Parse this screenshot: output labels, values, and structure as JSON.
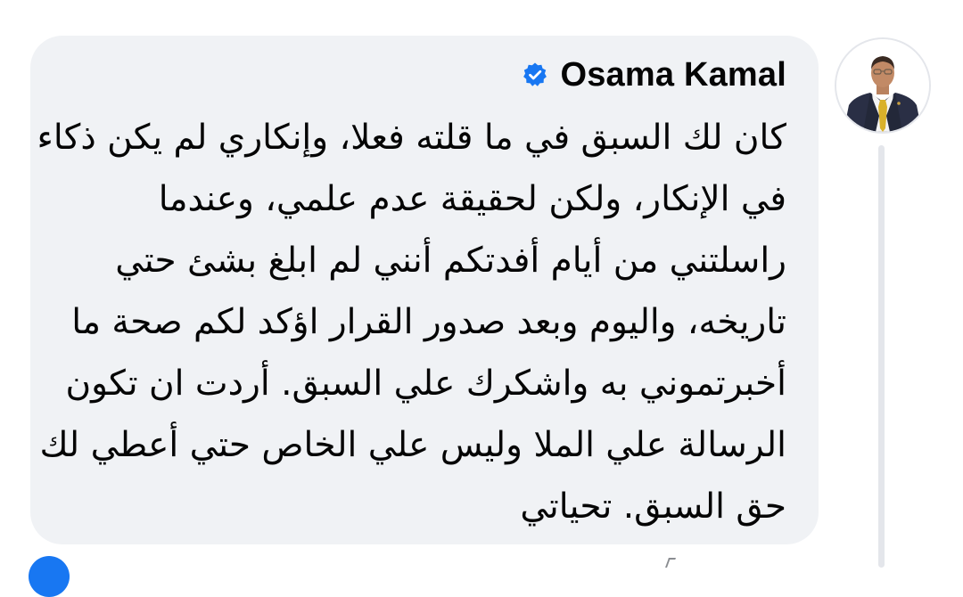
{
  "comment": {
    "author": "Osama Kamal",
    "verified_icon": "verified-badge-icon",
    "accent_color": "#1877f2",
    "bubble_color": "#f0f2f5",
    "lines": [
      "كان لك السبق في ما قلته فعلا، وإنكاري لم يكن ذكاء",
      "في الإنكار، ولكن لحقيقة عدم علمي، وعندما",
      "راسلتني من أيام أفدتكم أنني لم ابلغ بشئ حتي",
      "تاريخه، واليوم وبعد صدور القرار اؤكد لكم صحة ما",
      "أخبرتموني به واشكرك علي السبق. أردت ان تكون",
      "الرسالة علي الملا وليس علي الخاص حتي أعطي لك",
      "حق السبق. تحياتي"
    ]
  }
}
